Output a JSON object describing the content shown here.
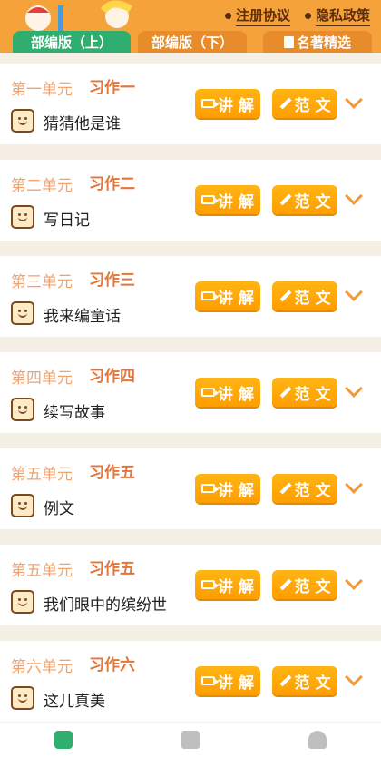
{
  "header": {
    "links": [
      "注册协议",
      "隐私政策"
    ],
    "tabs": [
      "部编版（上）",
      "部编版（下）",
      "名著精选"
    ]
  },
  "items": [
    {
      "unit": "第一单元",
      "zuowen": "习作一",
      "title": "猜猜他是谁"
    },
    {
      "unit": "第二单元",
      "zuowen": "习作二",
      "title": "写日记"
    },
    {
      "unit": "第三单元",
      "zuowen": "习作三",
      "title": "我来编童话"
    },
    {
      "unit": "第四单元",
      "zuowen": "习作四",
      "title": "续写故事"
    },
    {
      "unit": "第五单元",
      "zuowen": "习作五",
      "title": "例文"
    },
    {
      "unit": "第五单元",
      "zuowen": "习作五",
      "title": "我们眼中的缤纷世"
    },
    {
      "unit": "第六单元",
      "zuowen": "习作六",
      "title": "这儿真美"
    }
  ],
  "buttons": {
    "lecture": "讲 解",
    "sample": "范 文"
  },
  "bottom_nav": [
    "home-icon",
    "books-icon",
    "graduate-icon"
  ]
}
